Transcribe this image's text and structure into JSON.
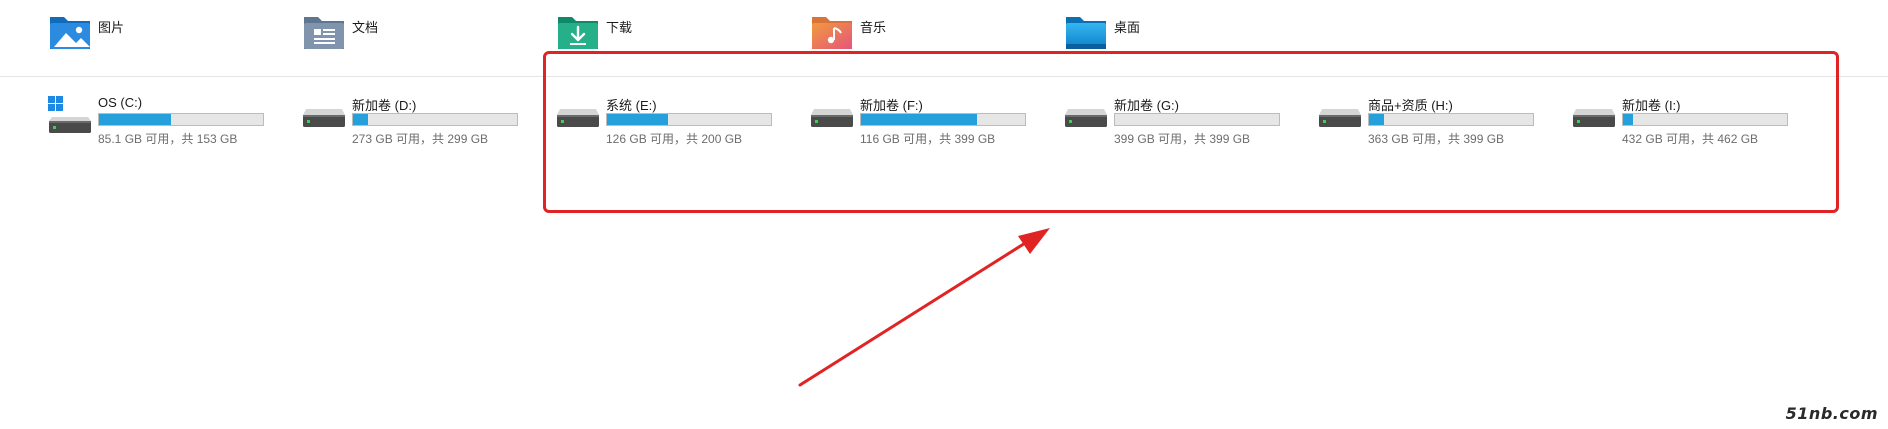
{
  "folders": [
    {
      "label": "图片",
      "icon": "pictures-folder-icon"
    },
    {
      "label": "文档",
      "icon": "documents-folder-icon"
    },
    {
      "label": "下载",
      "icon": "downloads-folder-icon"
    },
    {
      "label": "音乐",
      "icon": "music-folder-icon"
    },
    {
      "label": "桌面",
      "icon": "desktop-folder-icon"
    }
  ],
  "drives": [
    {
      "name": "OS (C:)",
      "info": "85.1 GB 可用，共 153 GB",
      "used_fraction": 0.44,
      "icon": "windows-system-drive-icon"
    },
    {
      "name": "新加卷 (D:)",
      "info": "273 GB 可用，共 299 GB",
      "used_fraction": 0.09,
      "icon": "hard-drive-icon"
    },
    {
      "name": "系统 (E:)",
      "info": "126 GB 可用，共 200 GB",
      "used_fraction": 0.37,
      "icon": "hard-drive-icon"
    },
    {
      "name": "新加卷 (F:)",
      "info": "116 GB 可用，共 399 GB",
      "used_fraction": 0.71,
      "icon": "hard-drive-icon"
    },
    {
      "name": "新加卷 (G:)",
      "info": "399 GB 可用，共 399 GB",
      "used_fraction": 0.0,
      "icon": "hard-drive-icon"
    },
    {
      "name": "商品+资质 (H:)",
      "info": "363 GB 可用，共 399 GB",
      "used_fraction": 0.09,
      "icon": "hard-drive-icon"
    },
    {
      "name": "新加卷 (I:)",
      "info": "432 GB 可用，共 462 GB",
      "used_fraction": 0.06,
      "icon": "hard-drive-icon"
    }
  ],
  "colors": {
    "bar_fill": "#26a0da",
    "bar_track": "#e6e6e6",
    "annotation": "#e02424"
  },
  "watermark": "51nb.com"
}
